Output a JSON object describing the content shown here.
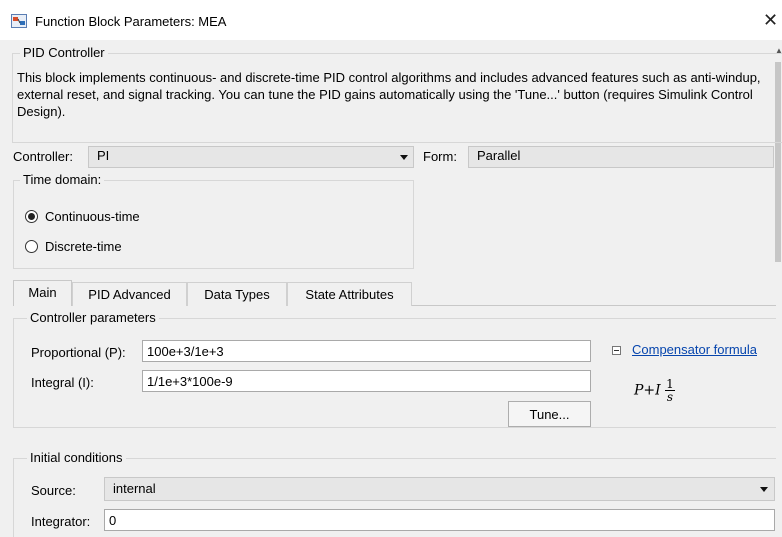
{
  "window": {
    "title": "Function Block Parameters: MEA",
    "close_glyph": "✕"
  },
  "block": {
    "name": "PID Controller",
    "description": "This block implements continuous- and discrete-time PID control algorithms and includes advanced features such as anti-windup, external reset, and signal tracking. You can tune the PID gains automatically using the 'Tune...' button (requires Simulink Control Design)."
  },
  "controller": {
    "label": "Controller:",
    "value": "PI",
    "form_label": "Form:",
    "form_value": "Parallel"
  },
  "time_domain": {
    "label": "Time domain:",
    "options": [
      {
        "label": "Continuous-time",
        "selected": true
      },
      {
        "label": "Discrete-time",
        "selected": false
      }
    ]
  },
  "tabs": [
    {
      "label": "Main",
      "active": true
    },
    {
      "label": "PID Advanced",
      "active": false
    },
    {
      "label": "Data Types",
      "active": false
    },
    {
      "label": "State Attributes",
      "active": false
    }
  ],
  "controller_parameters": {
    "label": "Controller parameters",
    "proportional_label": "Proportional (P):",
    "proportional_value": "100e+3/1e+3",
    "integral_label": "Integral (I):",
    "integral_value": "1/1e+3*100e-9",
    "tune_label": "Tune...",
    "compensator_link": "Compensator formula",
    "formula_p": "P",
    "formula_plus": "+",
    "formula_i": "I",
    "formula_num": "1",
    "formula_den": "s"
  },
  "initial_conditions": {
    "label": "Initial conditions",
    "source_label": "Source:",
    "source_value": "internal",
    "integrator_label": "Integrator:",
    "integrator_value": "0"
  },
  "icons": {
    "app": "simulink-block-icon",
    "close": "close-icon",
    "dropdown": "chevron-down-icon",
    "collapse": "collapse-minus-icon"
  }
}
